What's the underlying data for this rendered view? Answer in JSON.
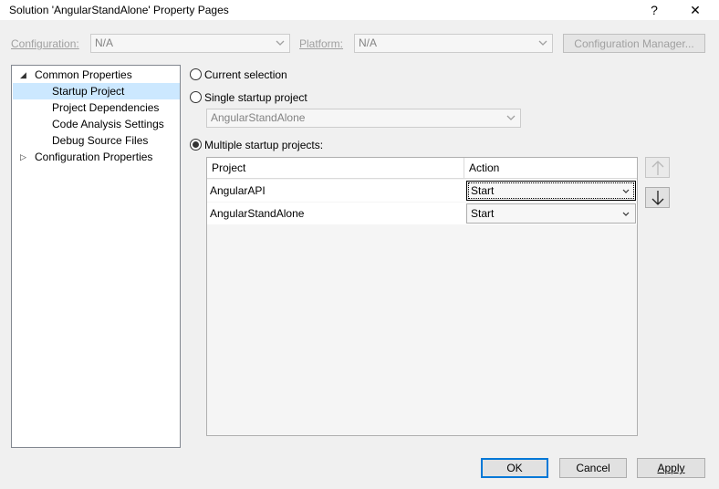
{
  "window": {
    "title": "Solution 'AngularStandAlone' Property Pages",
    "help_glyph": "?",
    "close_glyph": "✕"
  },
  "config_row": {
    "configuration_label": "Configuration:",
    "configuration_value": "N/A",
    "platform_label": "Platform:",
    "platform_value": "N/A",
    "config_manager_label": "Configuration Manager..."
  },
  "tree": {
    "items": [
      {
        "label": "Common Properties",
        "expander": "◢"
      },
      {
        "label": "Startup Project"
      },
      {
        "label": "Project Dependencies"
      },
      {
        "label": "Code Analysis Settings"
      },
      {
        "label": "Debug Source Files"
      },
      {
        "label": "Configuration Properties",
        "expander": "▷"
      }
    ]
  },
  "startup": {
    "current_selection_label": "Current selection",
    "single_startup_label": "Single startup project",
    "single_startup_value": "AngularStandAlone",
    "multiple_startup_label": "Multiple startup projects:"
  },
  "grid": {
    "headers": [
      "Project",
      "Action"
    ],
    "rows": [
      {
        "project": "AngularAPI",
        "action": "Start"
      },
      {
        "project": "AngularStandAlone",
        "action": "Start"
      }
    ]
  },
  "buttons": {
    "ok": "OK",
    "cancel": "Cancel",
    "apply": "Apply"
  },
  "colors": {
    "selection": "#cce8ff",
    "accent": "#0078d7"
  }
}
